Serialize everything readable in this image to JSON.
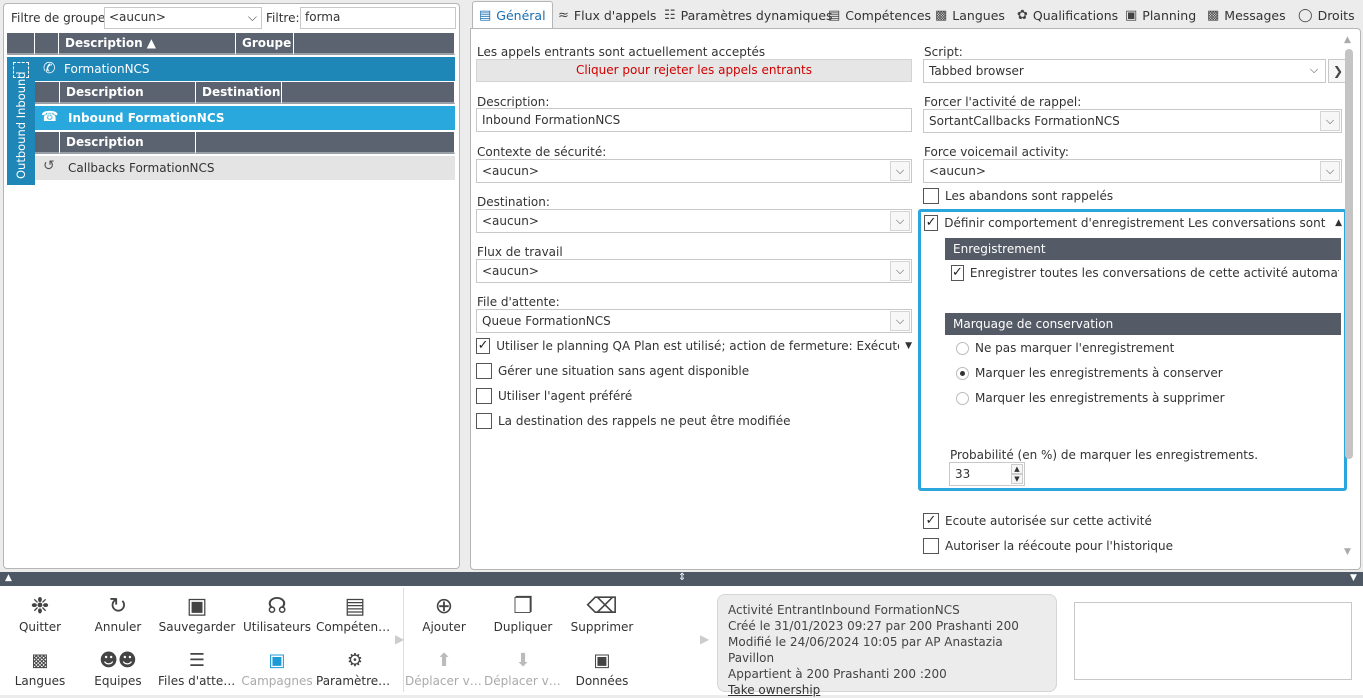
{
  "left": {
    "group_filter_label": "Filtre de groupe:",
    "group_filter_value": "<aucun>",
    "filter_label": "Filtre:",
    "filter_value": "forma",
    "columns": [
      "Description ▲",
      "Groupe"
    ],
    "vertical_tab": "Outbound Inbound",
    "campaign_row": "FormationNCS",
    "sub_columns": [
      "Description",
      "Destination"
    ],
    "inbound_row": "Inbound FormationNCS",
    "sub_columns2": [
      "Description"
    ],
    "callbacks_row": "Callbacks FormationNCS"
  },
  "tabs": [
    "Général",
    "Flux d'appels",
    "Paramètres dynamiques",
    "Compétences",
    "Langues",
    "Qualifications",
    "Planning",
    "Messages",
    "Droits"
  ],
  "form": {
    "accept_label": "Les appels entrants sont actuellement acceptés",
    "reject_button": "Cliquer pour rejeter les appels entrants",
    "description_label": "Description:",
    "description_value": "Inbound FormationNCS",
    "security_label": "Contexte de sécurité:",
    "security_value": "<aucun>",
    "destination_label": "Destination:",
    "destination_value": "<aucun>",
    "workflow_label": "Flux de travail",
    "workflow_value": "<aucun>",
    "queue_label": "File d'attente:",
    "queue_value": "Queue FormationNCS",
    "planning_label": "Utiliser le planning  QA Plan est utilisé; action de fermeture: Exécuter SVI D...",
    "no_agent_label": "Gérer une situation sans agent disponible",
    "preferred_agent_label": "Utiliser l'agent préféré",
    "callback_dest_label": "La destination des rappels ne peut être modifiée",
    "script_label": "Script:",
    "script_value": "Tabbed browser",
    "force_callback_label": "Forcer l'activité de rappel:",
    "force_callback_value": "SortantCallbacks FormationNCS",
    "voicemail_label": "Force voicemail activity:",
    "voicemail_value": "<aucun>",
    "abandons_label": "Les abandons sont rappelés",
    "recording_label": "Définir comportement d'enregistrement  Les conversations sont enregis...",
    "recording_section": "Enregistrement",
    "record_all_label": "Enregistrer toutes les conversations de cette activité automatiquemer",
    "marking_section": "Marquage de conservation",
    "radio_options": [
      "Ne pas marquer l'enregistrement",
      "Marquer les enregistrements à conserver",
      "Marquer les enregistrements à supprimer"
    ],
    "probability_label": "Probabilité (en %) de marquer les enregistrements.",
    "probability_value": "33",
    "listen_label": "Ecoute autorisée sur cette activité",
    "relisten_label": "Autoriser la réécoute pour l'historique"
  },
  "toolbar": {
    "group1": [
      {
        "label": "Quitter",
        "icon": "exit-icon"
      },
      {
        "label": "Annuler",
        "icon": "undo-icon"
      },
      {
        "label": "Sauvegarder",
        "icon": "save-icon"
      },
      {
        "label": "Utilisateurs",
        "icon": "headset-icon"
      },
      {
        "label": "Compétences",
        "icon": "document-icon"
      },
      {
        "label": "Langues",
        "icon": "language-icon"
      },
      {
        "label": "Equipes",
        "icon": "team-icon"
      },
      {
        "label": "Files d'atten...",
        "icon": "queue-icon"
      },
      {
        "label": "Campagnes",
        "icon": "monitor-icon"
      },
      {
        "label": "Paramètres...",
        "icon": "user-settings-icon"
      }
    ],
    "group2": [
      {
        "label": "Ajouter",
        "icon": "add-icon"
      },
      {
        "label": "Dupliquer",
        "icon": "duplicate-icon"
      },
      {
        "label": "Supprimer",
        "icon": "trash-icon"
      },
      {
        "label": "Déplacer ve...",
        "icon": "move-up-icon"
      },
      {
        "label": "Déplacer ve...",
        "icon": "move-down-icon"
      },
      {
        "label": "Données",
        "icon": "data-folder-icon"
      }
    ]
  },
  "info": {
    "line1": "Activité EntrantInbound FormationNCS",
    "line2": "Créé le 31/01/2023 09:27 par 200 Prashanti 200",
    "line3": "Modifié le 24/06/2024 10:05 par AP Anastazia Pavillon",
    "line4": "Appartient à 200 Prashanti 200 :200",
    "link": "Take ownership"
  }
}
